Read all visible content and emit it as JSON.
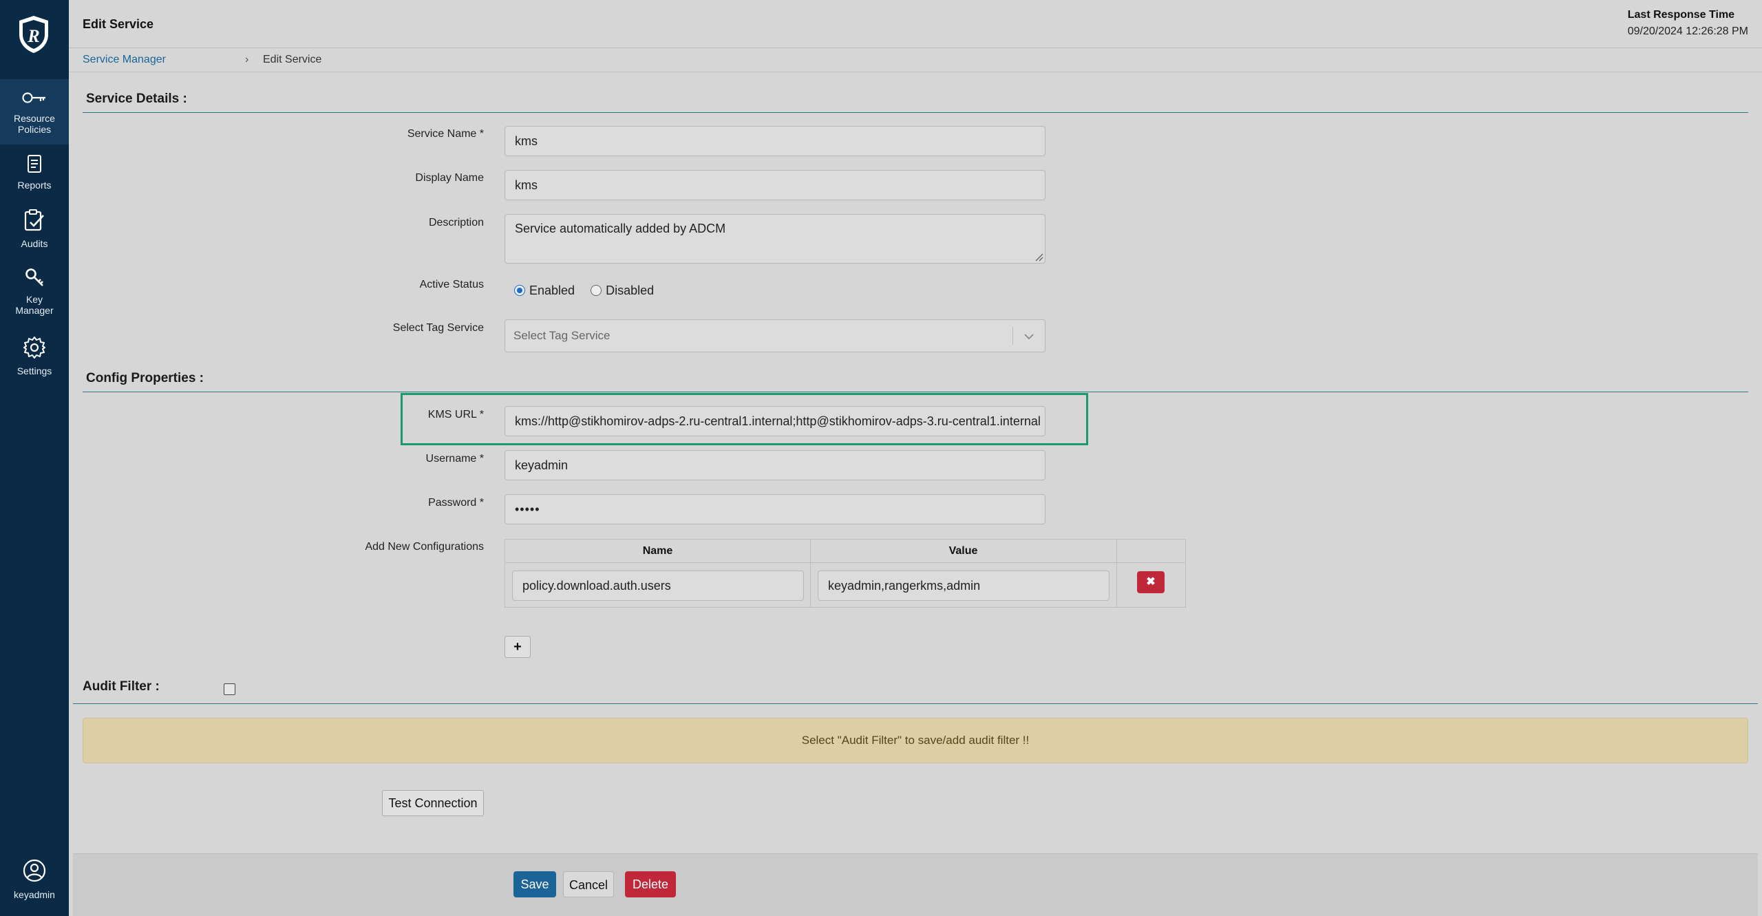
{
  "sidebar": {
    "items": [
      {
        "label_lines": [
          "Resource",
          "Policies"
        ],
        "icon": "key-icon",
        "active": true
      },
      {
        "label_lines": [
          "Reports"
        ],
        "icon": "document-icon",
        "active": false
      },
      {
        "label_lines": [
          "Audits"
        ],
        "icon": "clipboard-check-icon",
        "active": false
      },
      {
        "label_lines": [
          "Key",
          "Manager"
        ],
        "icon": "key-search-icon",
        "active": false
      },
      {
        "label_lines": [
          "Settings"
        ],
        "icon": "gear-icon",
        "active": false
      }
    ],
    "user": {
      "label": "keyadmin",
      "icon": "user-circle-icon"
    }
  },
  "header": {
    "title": "Edit Service",
    "last_response_label": "Last Response Time",
    "last_response_time": "09/20/2024 12:26:28 PM"
  },
  "breadcrumb": {
    "parent": "Service Manager",
    "separator": "›",
    "current": "Edit Service"
  },
  "service_details": {
    "title": "Service Details :",
    "service_name_label": "Service Name *",
    "service_name": "kms",
    "display_name_label": "Display Name",
    "display_name": "kms",
    "description_label": "Description",
    "description": "Service automatically added by ADCM",
    "active_status_label": "Active Status",
    "status_enabled": "Enabled",
    "status_disabled": "Disabled",
    "status_selected": "Enabled",
    "tag_service_label": "Select Tag Service",
    "tag_service_placeholder": "Select Tag Service"
  },
  "config_properties": {
    "title": "Config Properties :",
    "kms_url_label": "KMS URL *",
    "kms_url": "kms://http@stikhomirov-adps-2.ru-central1.internal;http@stikhomirov-adps-3.ru-central1.internal",
    "username_label": "Username *",
    "username": "keyadmin",
    "password_label": "Password *",
    "password": "•••••",
    "add_new_label": "Add New Configurations",
    "table_headers": {
      "name": "Name",
      "value": "Value"
    },
    "rows": [
      {
        "name": "policy.download.auth.users",
        "value": "keyadmin,rangerkms,admin"
      }
    ],
    "delete_symbol": "✖",
    "add_symbol": "+"
  },
  "audit_filter": {
    "title": "Audit Filter :",
    "checked": false,
    "notice": "Select \"Audit Filter\" to save/add audit filter !!"
  },
  "actions": {
    "test_connection": "Test Connection",
    "save": "Save",
    "cancel": "Cancel",
    "delete": "Delete"
  },
  "colors": {
    "sidebar_bg": "#0b2a45",
    "primary": "#1a6497",
    "danger": "#c0283a",
    "highlight": "#1a9a6a",
    "warning_bg": "#dccfa8"
  }
}
